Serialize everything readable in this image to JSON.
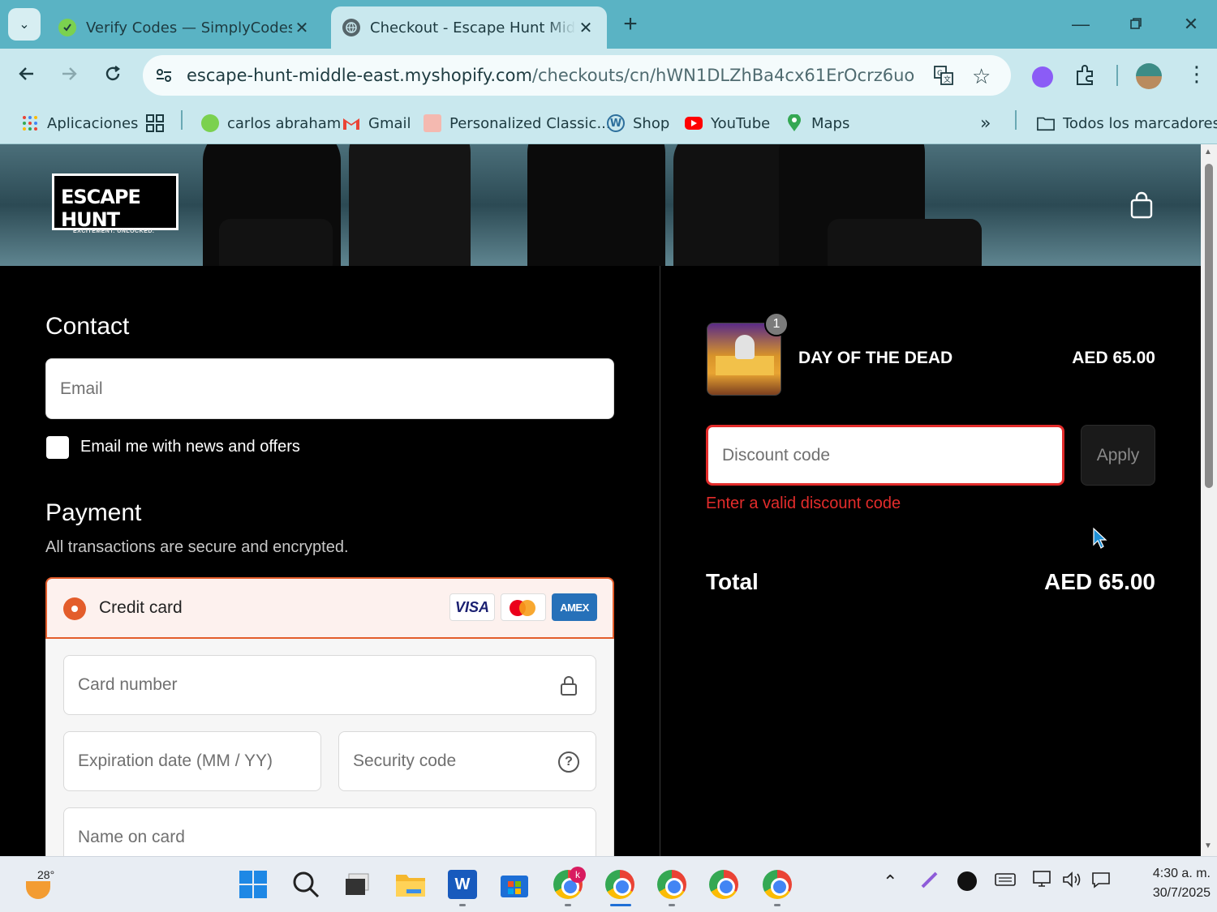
{
  "browser": {
    "tabs": [
      {
        "title": "Verify Codes — SimplyCodes",
        "active": false
      },
      {
        "title": "Checkout - Escape Hunt Middle East",
        "active": true
      }
    ],
    "url_domain": "escape-hunt-middle-east.myshopify.com",
    "url_path": "/checkouts/cn/hWN1DLZhBa4cx61ErOcrz6uo",
    "bookmarks": [
      "Aplicaciones",
      "carlos abraham",
      "Gmail",
      "Personalized Classic...",
      "Shop",
      "YouTube",
      "Maps"
    ],
    "all_bookmarks": "Todos los marcadores"
  },
  "store": {
    "logo_text": "ESCAPE HUNT",
    "logo_tagline": "EXCITEMENT. UNLOCKED."
  },
  "contact": {
    "heading": "Contact",
    "email_placeholder": "Email",
    "newsletter_label": "Email me with news and offers"
  },
  "payment": {
    "heading": "Payment",
    "subtitle": "All transactions are secure and encrypted.",
    "method_label": "Credit card",
    "card_brands": [
      "VISA",
      "AMEX"
    ],
    "card_number_placeholder": "Card number",
    "expiry_placeholder": "Expiration date (MM / YY)",
    "security_placeholder": "Security code",
    "name_placeholder": "Name on card"
  },
  "order": {
    "item_name": "DAY OF THE DEAD",
    "item_qty": "1",
    "item_price": "AED 65.00",
    "discount_placeholder": "Discount code",
    "apply_label": "Apply",
    "discount_error": "Enter a valid discount code",
    "total_label": "Total",
    "total_value": "AED 65.00"
  },
  "taskbar": {
    "weather_temp": "28°",
    "time": "4:30 a. m.",
    "date": "30/7/2025",
    "chrome_badge": "k"
  },
  "colors": {
    "chrome_teal": "#5ab3c4",
    "error_red": "#e32c2b",
    "accent_orange": "#e35d2b"
  }
}
